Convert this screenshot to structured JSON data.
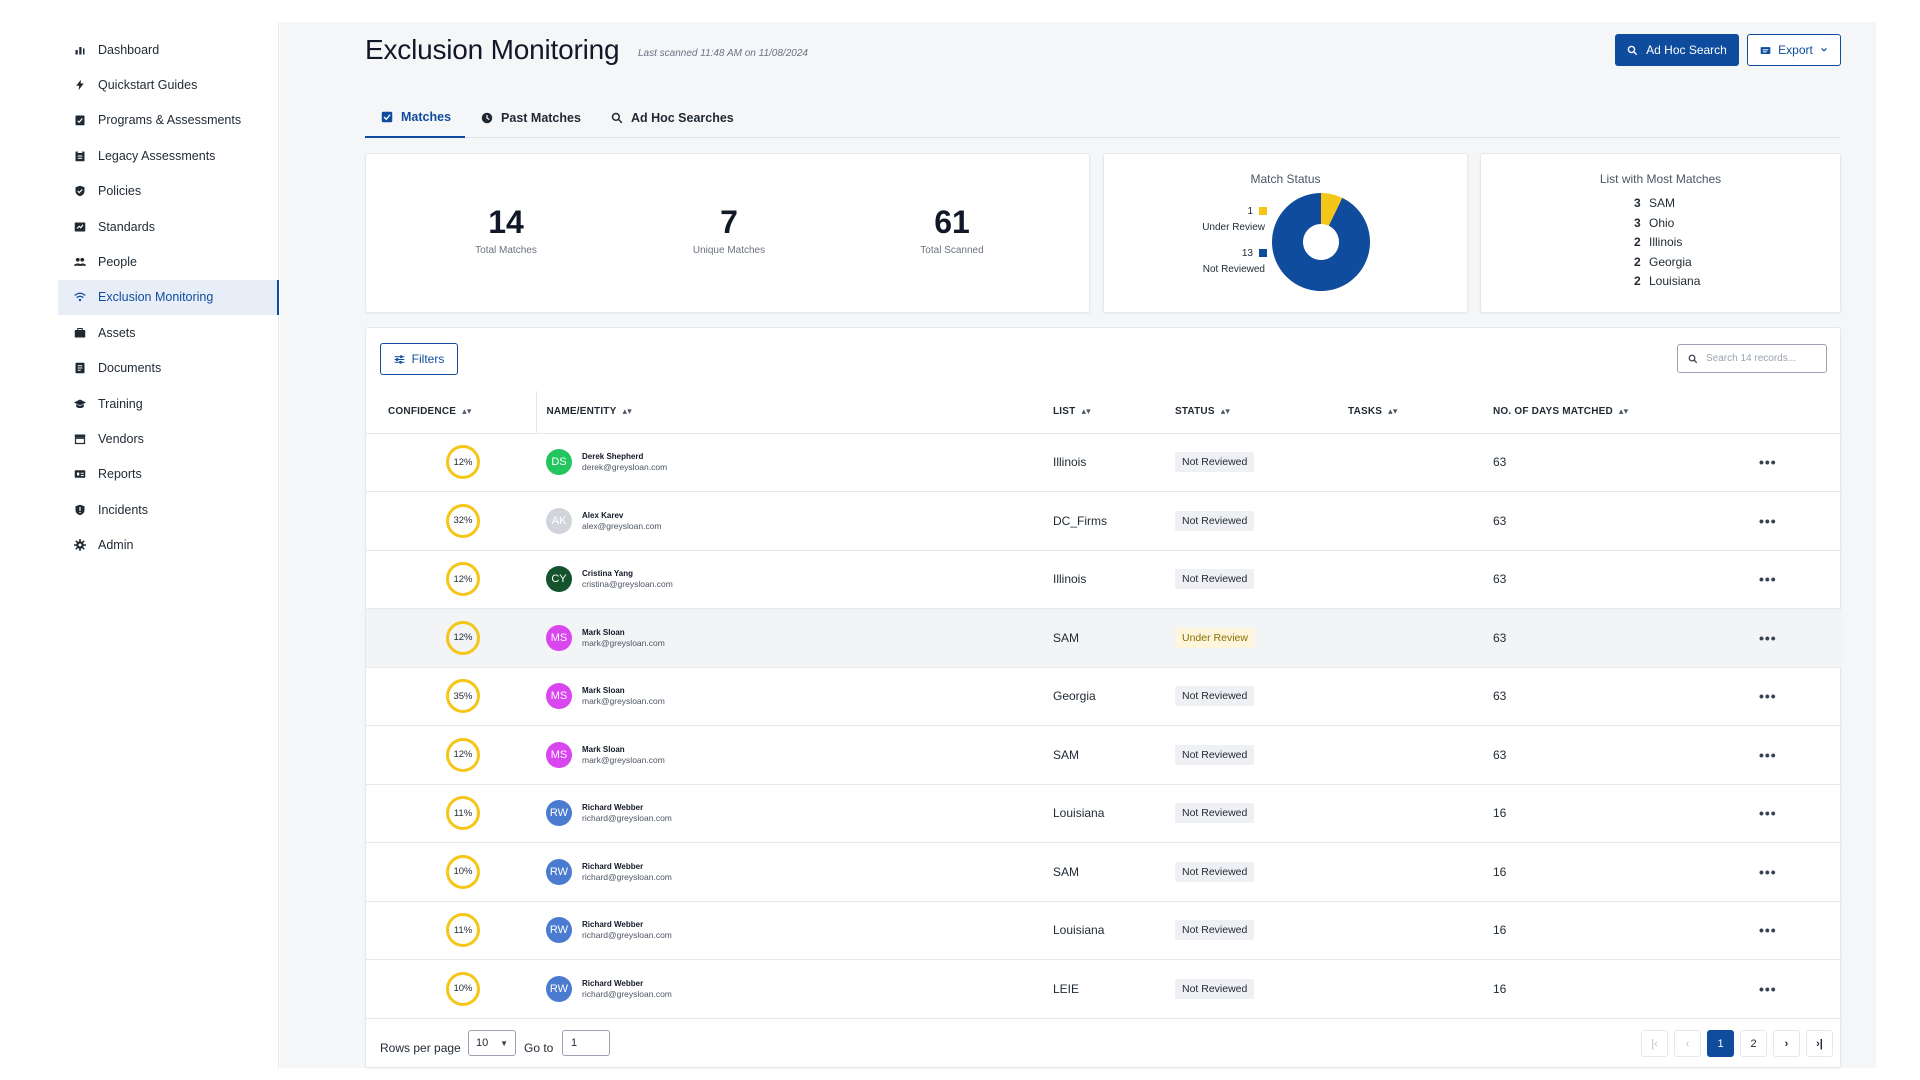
{
  "sidebar": {
    "items": [
      {
        "label": "Dashboard",
        "icon": "bar-chart-icon",
        "active": false
      },
      {
        "label": "Quickstart Guides",
        "icon": "bolt-icon",
        "active": false
      },
      {
        "label": "Programs & Assessments",
        "icon": "clipboard-check-icon",
        "active": false
      },
      {
        "label": "Legacy Assessments",
        "icon": "clipboard-icon",
        "active": false
      },
      {
        "label": "Policies",
        "icon": "shield-check-icon",
        "active": false
      },
      {
        "label": "Standards",
        "icon": "standards-icon",
        "active": false
      },
      {
        "label": "People",
        "icon": "people-icon",
        "active": false
      },
      {
        "label": "Exclusion Monitoring",
        "icon": "wifi-icon",
        "active": true
      },
      {
        "label": "Assets",
        "icon": "briefcase-icon",
        "active": false
      },
      {
        "label": "Documents",
        "icon": "document-icon",
        "active": false
      },
      {
        "label": "Training",
        "icon": "graduation-cap-icon",
        "active": false
      },
      {
        "label": "Vendors",
        "icon": "storefront-icon",
        "active": false
      },
      {
        "label": "Reports",
        "icon": "reports-icon",
        "active": false
      },
      {
        "label": "Incidents",
        "icon": "shield-alert-icon",
        "active": false
      },
      {
        "label": "Admin",
        "icon": "gear-icon",
        "active": false
      }
    ]
  },
  "header": {
    "title": "Exclusion Monitoring",
    "last_scanned": "Last scanned 11:48 AM on 11/08/2024",
    "adhoc_label": "Ad Hoc Search",
    "export_label": "Export"
  },
  "tabs": [
    {
      "label": "Matches",
      "icon": "checkbox-icon",
      "active": true
    },
    {
      "label": "Past Matches",
      "icon": "history-icon",
      "active": false
    },
    {
      "label": "Ad Hoc Searches",
      "icon": "search-icon",
      "active": false
    }
  ],
  "stats": {
    "total_matches": {
      "value": "14",
      "label": "Total Matches"
    },
    "unique_matches": {
      "value": "7",
      "label": "Unique Matches"
    },
    "total_scanned": {
      "value": "61",
      "label": "Total Scanned"
    }
  },
  "match_status": {
    "title": "Match Status",
    "segments": [
      {
        "label": "Under Review",
        "count": 1,
        "count_text": "1",
        "color": "#f5c518"
      },
      {
        "label": "Not Reviewed",
        "count": 13,
        "count_text": "13",
        "color": "#0f4c9e"
      }
    ]
  },
  "most_matches": {
    "title": "List with Most Matches",
    "items": [
      {
        "count": "3",
        "name": "SAM"
      },
      {
        "count": "3",
        "name": "Ohio"
      },
      {
        "count": "2",
        "name": "Illinois"
      },
      {
        "count": "2",
        "name": "Georgia"
      },
      {
        "count": "2",
        "name": "Louisiana"
      }
    ]
  },
  "table": {
    "filters_label": "Filters",
    "search_placeholder": "Search 14 records...",
    "columns": [
      "CONFIDENCE",
      "NAME/ENTITY",
      "LIST",
      "STATUS",
      "TASKS",
      "NO. OF DAYS MATCHED"
    ],
    "rows": [
      {
        "confidence": "12%",
        "initials": "DS",
        "avatar_color": "#22c55e",
        "name": "Derek Shepherd",
        "email": "derek@greysloan.com",
        "list": "Illinois",
        "status": "Not Reviewed",
        "tasks": "",
        "days": "63"
      },
      {
        "confidence": "32%",
        "initials": "AK",
        "avatar_color": "#d1d5db",
        "name": "Alex Karev",
        "email": "alex@greysloan.com",
        "list": "DC_Firms",
        "status": "Not Reviewed",
        "tasks": "",
        "days": "63"
      },
      {
        "confidence": "12%",
        "initials": "CY",
        "avatar_color": "#14532d",
        "name": "Cristina Yang",
        "email": "cristina@greysloan.com",
        "list": "Illinois",
        "status": "Not Reviewed",
        "tasks": "",
        "days": "63"
      },
      {
        "confidence": "12%",
        "initials": "MS",
        "avatar_color": "#d946ef",
        "name": "Mark Sloan",
        "email": "mark@greysloan.com",
        "list": "SAM",
        "status": "Under Review",
        "tasks": "",
        "days": "63"
      },
      {
        "confidence": "35%",
        "initials": "MS",
        "avatar_color": "#d946ef",
        "name": "Mark Sloan",
        "email": "mark@greysloan.com",
        "list": "Georgia",
        "status": "Not Reviewed",
        "tasks": "",
        "days": "63"
      },
      {
        "confidence": "12%",
        "initials": "MS",
        "avatar_color": "#d946ef",
        "name": "Mark Sloan",
        "email": "mark@greysloan.com",
        "list": "SAM",
        "status": "Not Reviewed",
        "tasks": "",
        "days": "63"
      },
      {
        "confidence": "11%",
        "initials": "RW",
        "avatar_color": "#4a7bd0",
        "name": "Richard Webber",
        "email": "richard@greysloan.com",
        "list": "Louisiana",
        "status": "Not Reviewed",
        "tasks": "",
        "days": "16"
      },
      {
        "confidence": "10%",
        "initials": "RW",
        "avatar_color": "#4a7bd0",
        "name": "Richard Webber",
        "email": "richard@greysloan.com",
        "list": "SAM",
        "status": "Not Reviewed",
        "tasks": "",
        "days": "16"
      },
      {
        "confidence": "11%",
        "initials": "RW",
        "avatar_color": "#4a7bd0",
        "name": "Richard Webber",
        "email": "richard@greysloan.com",
        "list": "Louisiana",
        "status": "Not Reviewed",
        "tasks": "",
        "days": "16"
      },
      {
        "confidence": "10%",
        "initials": "RW",
        "avatar_color": "#4a7bd0",
        "name": "Richard Webber",
        "email": "richard@greysloan.com",
        "list": "LEIE",
        "status": "Not Reviewed",
        "tasks": "",
        "days": "16"
      }
    ]
  },
  "pagination": {
    "rows_label": "Rows per page",
    "rows_value": "10",
    "goto_label": "Go to",
    "goto_value": "1",
    "pages": [
      "1",
      "2"
    ],
    "current_page": "1"
  },
  "colors": {
    "primary": "#0f4c9e",
    "accent_yellow": "#f5c518",
    "active_nav_bg": "#e8eef8"
  }
}
